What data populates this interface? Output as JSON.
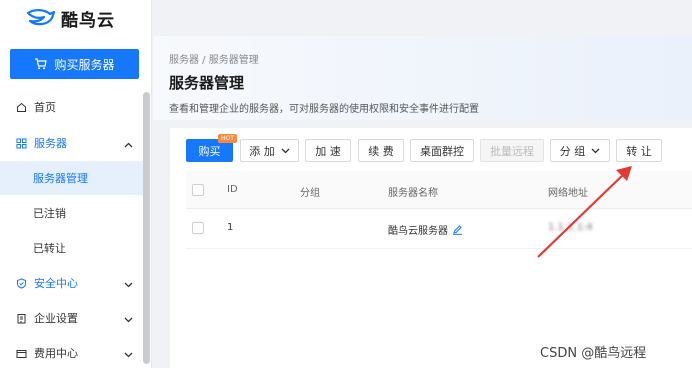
{
  "brand": {
    "name": "酷鸟云"
  },
  "sidebar": {
    "buy_label": "购买服务器",
    "items": [
      {
        "label": "首页"
      },
      {
        "label": "服务器"
      },
      {
        "label": "安全中心"
      },
      {
        "label": "企业设置"
      },
      {
        "label": "费用中心"
      }
    ],
    "sub_items": [
      {
        "label": "服务器管理"
      },
      {
        "label": "已注销"
      },
      {
        "label": "已转让"
      }
    ]
  },
  "header": {
    "breadcrumb": "服务器 / 服务器管理",
    "title": "服务器管理",
    "description": "查看和管理企业的服务器，可对服务器的使用权限和安全事件进行配置"
  },
  "toolbar": {
    "buy": "购买",
    "hot_badge": "HOT",
    "add": "添 加",
    "accelerate": "加 速",
    "renew": "续 费",
    "desktop_control": "桌面群控",
    "batch_remote": "批量远程",
    "group": "分 组",
    "transfer": "转 让"
  },
  "table": {
    "columns": [
      "ID",
      "分组",
      "服务器名称",
      "网络地址"
    ],
    "rows": [
      {
        "id": "1",
        "group": "",
        "name": "酷鸟云服务器",
        "address": "1.1.1.1:4"
      }
    ]
  },
  "watermark": "CSDN @酷鸟远程",
  "colors": {
    "accent": "#1677ff",
    "arrow": "#e53935",
    "hot": "#ff8a3d"
  }
}
